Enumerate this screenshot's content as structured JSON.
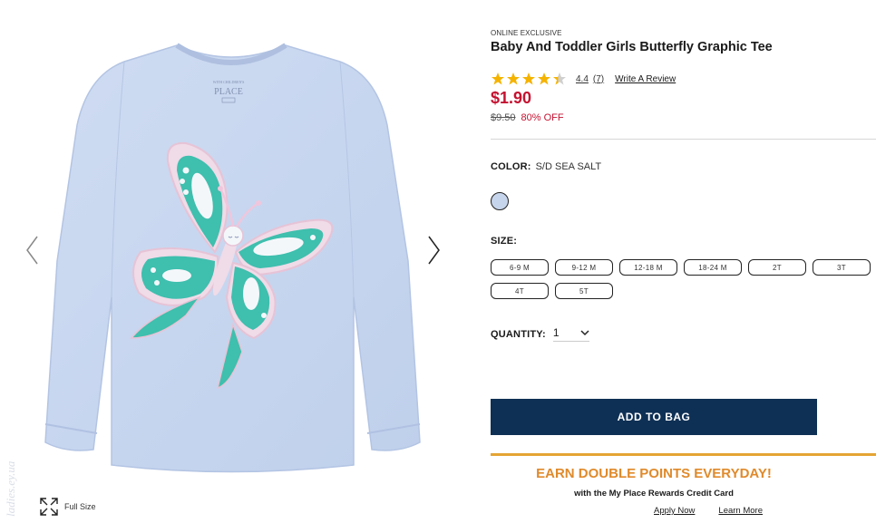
{
  "product": {
    "badge": "ONLINE EXCLUSIVE",
    "title": "Baby And Toddler Girls Butterfly Graphic Tee",
    "rating_value": "4.4",
    "rating_stars": 4.4,
    "rating_count": "(7)",
    "write_review": "Write A Review",
    "price": "$1.90",
    "original_price": "$9.50",
    "discount": "80% OFF",
    "tag_brand": "PLACE"
  },
  "color": {
    "label": "COLOR:",
    "value": "S/D SEA SALT",
    "swatch_hex": "#c7d5ec"
  },
  "size": {
    "label": "SIZE:",
    "options": [
      "6-9 M",
      "9-12 M",
      "12-18 M",
      "18-24 M",
      "2T",
      "3T",
      "4T",
      "5T"
    ]
  },
  "quantity": {
    "label": "QUANTITY:",
    "value": "1"
  },
  "actions": {
    "add_to_bag": "ADD TO BAG",
    "full_size": "Full Size"
  },
  "promo": {
    "title": "EARN DOUBLE POINTS EVERYDAY!",
    "subtitle": "with the My Place Rewards Credit Card",
    "apply": "Apply Now",
    "learn": "Learn More"
  },
  "watermark": "ladies.ey.ua",
  "colors": {
    "accent_red": "#c41230",
    "navy": "#0f3055",
    "promo_orange": "#e08a2b",
    "promo_line": "#e4a434",
    "star": "#f5b301"
  },
  "icons": {
    "prev": "chevron-left-icon",
    "next": "chevron-right-icon",
    "expand": "expand-icon",
    "star": "star-icon",
    "dropdown": "chevron-down-icon"
  }
}
